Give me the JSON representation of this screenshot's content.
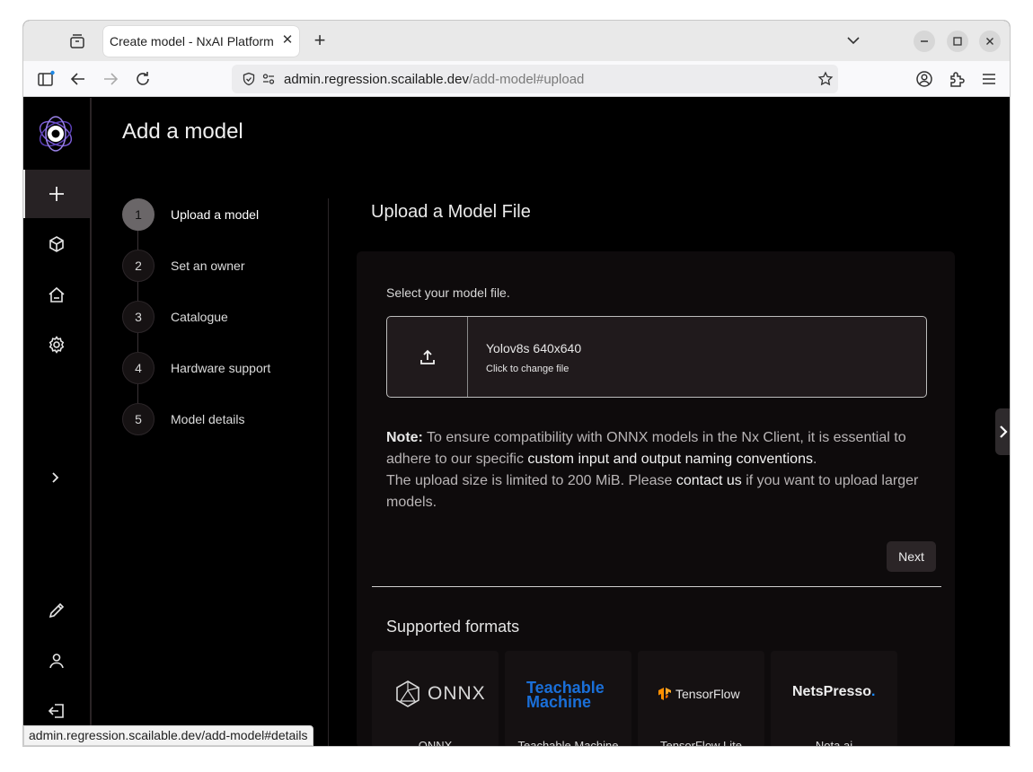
{
  "browser": {
    "tab_title": "Create model - NxAI Platform",
    "url_host": "admin.regression.scailable.dev",
    "url_path": "/add-model#upload",
    "status_url": "admin.regression.scailable.dev/add-model#details"
  },
  "app": {
    "page_title": "Add a model",
    "nav": [
      "plus-icon",
      "cube-icon",
      "home-icon",
      "gear-icon",
      "chevron-right-icon",
      "pencil-icon",
      "user-icon",
      "logout-icon"
    ]
  },
  "stepper": {
    "steps": [
      {
        "number": "1",
        "label": "Upload a model",
        "active": true
      },
      {
        "number": "2",
        "label": "Set an owner"
      },
      {
        "number": "3",
        "label": "Catalogue"
      },
      {
        "number": "4",
        "label": "Hardware support"
      },
      {
        "number": "5",
        "label": "Model details"
      }
    ]
  },
  "upload": {
    "section_title": "Upload a Model File",
    "hint": "Select your model file.",
    "file_name": "Yolov8s 640x640",
    "file_sub": "Click to change file",
    "note_prefix": "Note:",
    "note_text_1": " To ensure compatibility with ONNX models in the Nx Client, it is essential to adhere to our specific ",
    "note_link_1": "custom input and output naming conventions",
    "note_text_2": ".",
    "note_text_3": "The upload size is limited to 200 MiB. Please ",
    "note_link_2": "contact us",
    "note_text_4": " if you want to upload larger models.",
    "next_label": "Next",
    "formats_title": "Supported formats",
    "formats": [
      {
        "logo_text": "ONNX",
        "label": "ONNX"
      },
      {
        "logo_line1": "Teachable",
        "logo_line2": "Machine",
        "label": "Teachable Machine"
      },
      {
        "logo_text": "TensorFlow",
        "label": "TensorFlow Lite"
      },
      {
        "logo_text": "NetsPresso",
        "logo_dot": ".",
        "label": "Nota ai"
      }
    ]
  },
  "colors": {
    "accent_logo": "#7b5cd6",
    "teachable_blue": "#1a6fd8",
    "tensorflow_orange": "#ff8f00"
  }
}
